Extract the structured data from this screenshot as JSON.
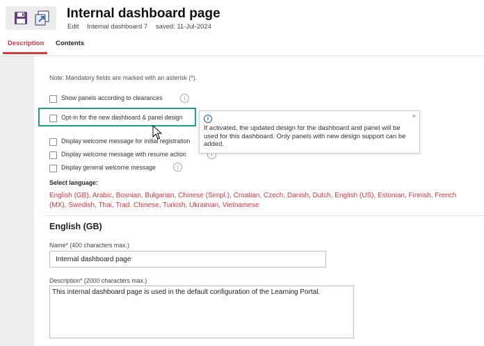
{
  "header": {
    "title": "Internal dashboard page",
    "mode": "Edit",
    "record": "Internal dashboard 7",
    "saved": "saved: 11-Jul-2024"
  },
  "toolbar": {
    "save_icon": "save-icon",
    "save_as_icon": "save-as-icon"
  },
  "tabs": [
    {
      "label": "Description",
      "active": true
    },
    {
      "label": "Contents",
      "active": false
    }
  ],
  "form": {
    "note": "Note: Mandatory fields are marked with an asterisk (*).",
    "checkboxes": [
      {
        "label": "Show panels according to clearances",
        "checked": false
      },
      {
        "label": "Opt-in for the new dashboard & panel design",
        "checked": false
      },
      {
        "label": "Display welcome message for initial registration",
        "checked": false
      },
      {
        "label": "Display welcome message with resume action",
        "checked": false
      },
      {
        "label": "Display general welcome message",
        "checked": false
      }
    ],
    "tooltip": {
      "text": "If activated, the updated design for the dashboard and panel will be used for this dashboard. Only panels with new design support can be added.",
      "close": "×"
    },
    "select_language_label": "Select language:",
    "languages": [
      "English (GB)",
      "Arabic",
      "Bosnian",
      "Bulgarian",
      "Chinese (Simpl.)",
      "Croatian",
      "Czech",
      "Danish",
      "Dutch",
      "English (US)",
      "Estonian",
      "Finnish",
      "French",
      "(MX)",
      "Swedish",
      "Thai",
      "Trad. Chinese",
      "Turkish",
      "Ukrainian",
      "Vietnamese"
    ],
    "section_title": "English (GB)",
    "name_label": "Name* (400 characters max.)",
    "name_value": "Internal dashboard page",
    "description_label": "Description* (2000 characters max.)",
    "description_value": "This internal dashboard page is used in the default configuration of the Learning Portal."
  },
  "colors": {
    "accent": "#d9363e",
    "highlight": "#21a08a",
    "info": "#1f5fae"
  }
}
